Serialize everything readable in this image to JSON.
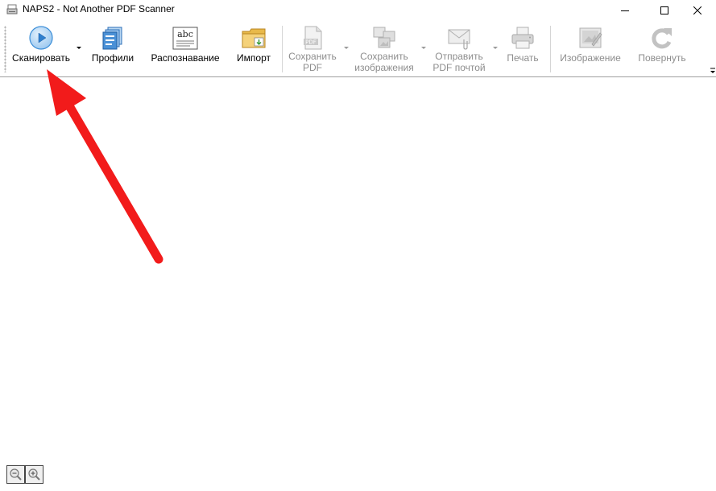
{
  "window": {
    "title": "NAPS2 - Not Another PDF Scanner",
    "app_icon": "scanner-icon"
  },
  "window_controls": {
    "minimize_icon": "minimize-icon",
    "maximize_icon": "maximize-icon",
    "close_icon": "close-icon"
  },
  "toolbar": {
    "scan": {
      "label": "Сканировать",
      "icon": "play-circle-icon",
      "enabled": true
    },
    "profiles": {
      "label": "Профили",
      "icon": "profiles-icon",
      "enabled": true
    },
    "ocr": {
      "label": "Распознавание",
      "icon": "abc-ocr-icon",
      "enabled": true
    },
    "import": {
      "label": "Импорт",
      "icon": "folder-import-icon",
      "enabled": true
    },
    "save_pdf": {
      "label_line1": "Сохранить",
      "label_line2": "PDF",
      "icon": "pdf-icon",
      "enabled": false
    },
    "save_images": {
      "label_line1": "Сохранить",
      "label_line2": "изображения",
      "icon": "images-icon",
      "enabled": false
    },
    "email_pdf": {
      "label_line1": "Отправить",
      "label_line2": "PDF почтой",
      "icon": "email-icon",
      "enabled": false
    },
    "print": {
      "label": "Печать",
      "icon": "printer-icon",
      "enabled": false
    },
    "image": {
      "label": "Изображение",
      "icon": "image-edit-icon",
      "enabled": false
    },
    "rotate": {
      "label": "Повернуть",
      "icon": "rotate-icon",
      "enabled": false
    }
  },
  "zoom": {
    "zoom_out_icon": "zoom-out-icon",
    "zoom_in_icon": "zoom-in-icon"
  },
  "colors": {
    "annotation_arrow": "#f21b1b",
    "disabled_text": "#8d8d8d",
    "scan_icon_blue": "#3d8fd8"
  }
}
